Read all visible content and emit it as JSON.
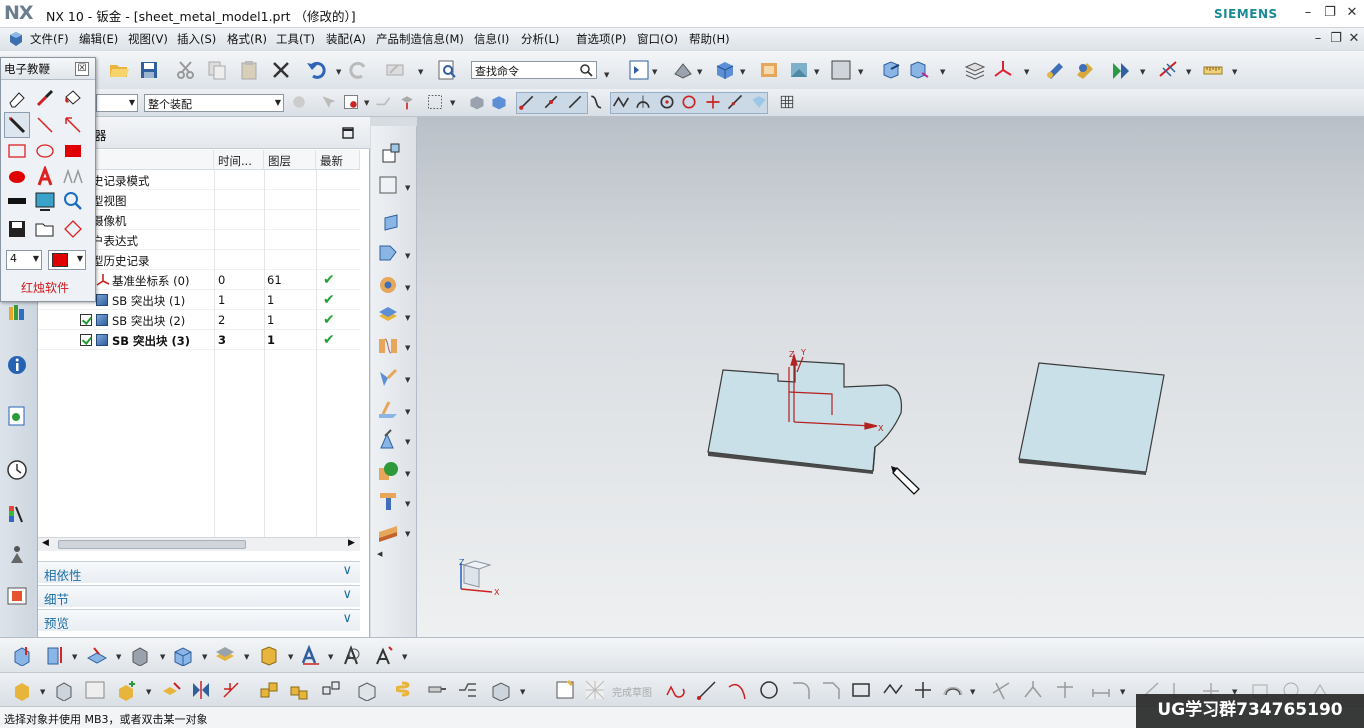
{
  "window": {
    "logo": "NX",
    "title": "NX 10 - 钣金 - [sheet_metal_model1.prt （修改的）]",
    "brand": "SIEMENS",
    "min_icon": "minimize-icon",
    "restore_icon": "restore-icon",
    "close_icon": "close-icon"
  },
  "menubar": {
    "items": [
      "文件(F)",
      "编辑(E)",
      "视图(V)",
      "插入(S)",
      "格式(R)",
      "工具(T)",
      "装配(A)",
      "产品制造信息(M)",
      "信息(I)",
      "分析(L)",
      "首选项(P)",
      "窗口(O)",
      "帮助(H)"
    ]
  },
  "toolbar": {
    "search_placeholder": "查找命令",
    "filter_value": "",
    "assembly_scope": "整个装配"
  },
  "navigator": {
    "title_partial": "器",
    "columns": [
      "时间...",
      "图层",
      "最新"
    ],
    "rows": [
      {
        "name": "史记录模式",
        "time": "",
        "layer": "",
        "latest": false,
        "checkbox": false
      },
      {
        "name": "型视图",
        "time": "",
        "layer": "",
        "latest": false,
        "checkbox": false
      },
      {
        "name": "摄像机",
        "time": "",
        "layer": "",
        "latest": false,
        "checkbox": false
      },
      {
        "name": "户表达式",
        "time": "",
        "layer": "",
        "latest": false,
        "checkbox": false
      },
      {
        "name": "型历史记录",
        "time": "",
        "layer": "",
        "latest": false,
        "checkbox": false
      },
      {
        "name": "基准坐标系 (0)",
        "time": "0",
        "layer": "61",
        "latest": true,
        "checkbox": false
      },
      {
        "name": "SB 突出块 (1)",
        "time": "1",
        "layer": "1",
        "latest": true,
        "checkbox": true
      },
      {
        "name": "SB 突出块 (2)",
        "time": "2",
        "layer": "1",
        "latest": true,
        "checkbox": true
      },
      {
        "name": "SB 突出块 (3)",
        "time": "3",
        "layer": "1",
        "latest": true,
        "checkbox": true,
        "bold": true
      }
    ],
    "sections": [
      "相依性",
      "细节",
      "预览"
    ]
  },
  "redpen_tool": {
    "title": "电子教鞭",
    "line_width": "4",
    "color": "#e10000",
    "footer": "红烛软件"
  },
  "graphics": {
    "part_color": "#c9e0e8",
    "edge_color": "#3a3a3a",
    "axis_color": "#c01818"
  },
  "sketch_toolbar": {
    "finish_label": "完成草图"
  },
  "status": {
    "message": "选择对象并使用 MB3，或者双击某一对象"
  },
  "watermark": "UG学习群734765190"
}
